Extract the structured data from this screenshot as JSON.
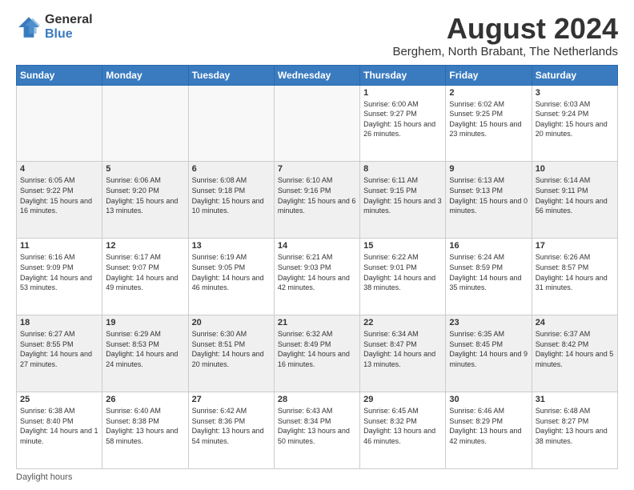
{
  "logo": {
    "general": "General",
    "blue": "Blue"
  },
  "title": "August 2024",
  "location": "Berghem, North Brabant, The Netherlands",
  "days_of_week": [
    "Sunday",
    "Monday",
    "Tuesday",
    "Wednesday",
    "Thursday",
    "Friday",
    "Saturday"
  ],
  "footer": "Daylight hours",
  "weeks": [
    {
      "shaded": false,
      "days": [
        {
          "num": "",
          "detail": ""
        },
        {
          "num": "",
          "detail": ""
        },
        {
          "num": "",
          "detail": ""
        },
        {
          "num": "",
          "detail": ""
        },
        {
          "num": "1",
          "detail": "Sunrise: 6:00 AM\nSunset: 9:27 PM\nDaylight: 15 hours\nand 26 minutes."
        },
        {
          "num": "2",
          "detail": "Sunrise: 6:02 AM\nSunset: 9:25 PM\nDaylight: 15 hours\nand 23 minutes."
        },
        {
          "num": "3",
          "detail": "Sunrise: 6:03 AM\nSunset: 9:24 PM\nDaylight: 15 hours\nand 20 minutes."
        }
      ]
    },
    {
      "shaded": true,
      "days": [
        {
          "num": "4",
          "detail": "Sunrise: 6:05 AM\nSunset: 9:22 PM\nDaylight: 15 hours\nand 16 minutes."
        },
        {
          "num": "5",
          "detail": "Sunrise: 6:06 AM\nSunset: 9:20 PM\nDaylight: 15 hours\nand 13 minutes."
        },
        {
          "num": "6",
          "detail": "Sunrise: 6:08 AM\nSunset: 9:18 PM\nDaylight: 15 hours\nand 10 minutes."
        },
        {
          "num": "7",
          "detail": "Sunrise: 6:10 AM\nSunset: 9:16 PM\nDaylight: 15 hours\nand 6 minutes."
        },
        {
          "num": "8",
          "detail": "Sunrise: 6:11 AM\nSunset: 9:15 PM\nDaylight: 15 hours\nand 3 minutes."
        },
        {
          "num": "9",
          "detail": "Sunrise: 6:13 AM\nSunset: 9:13 PM\nDaylight: 15 hours\nand 0 minutes."
        },
        {
          "num": "10",
          "detail": "Sunrise: 6:14 AM\nSunset: 9:11 PM\nDaylight: 14 hours\nand 56 minutes."
        }
      ]
    },
    {
      "shaded": false,
      "days": [
        {
          "num": "11",
          "detail": "Sunrise: 6:16 AM\nSunset: 9:09 PM\nDaylight: 14 hours\nand 53 minutes."
        },
        {
          "num": "12",
          "detail": "Sunrise: 6:17 AM\nSunset: 9:07 PM\nDaylight: 14 hours\nand 49 minutes."
        },
        {
          "num": "13",
          "detail": "Sunrise: 6:19 AM\nSunset: 9:05 PM\nDaylight: 14 hours\nand 46 minutes."
        },
        {
          "num": "14",
          "detail": "Sunrise: 6:21 AM\nSunset: 9:03 PM\nDaylight: 14 hours\nand 42 minutes."
        },
        {
          "num": "15",
          "detail": "Sunrise: 6:22 AM\nSunset: 9:01 PM\nDaylight: 14 hours\nand 38 minutes."
        },
        {
          "num": "16",
          "detail": "Sunrise: 6:24 AM\nSunset: 8:59 PM\nDaylight: 14 hours\nand 35 minutes."
        },
        {
          "num": "17",
          "detail": "Sunrise: 6:26 AM\nSunset: 8:57 PM\nDaylight: 14 hours\nand 31 minutes."
        }
      ]
    },
    {
      "shaded": true,
      "days": [
        {
          "num": "18",
          "detail": "Sunrise: 6:27 AM\nSunset: 8:55 PM\nDaylight: 14 hours\nand 27 minutes."
        },
        {
          "num": "19",
          "detail": "Sunrise: 6:29 AM\nSunset: 8:53 PM\nDaylight: 14 hours\nand 24 minutes."
        },
        {
          "num": "20",
          "detail": "Sunrise: 6:30 AM\nSunset: 8:51 PM\nDaylight: 14 hours\nand 20 minutes."
        },
        {
          "num": "21",
          "detail": "Sunrise: 6:32 AM\nSunset: 8:49 PM\nDaylight: 14 hours\nand 16 minutes."
        },
        {
          "num": "22",
          "detail": "Sunrise: 6:34 AM\nSunset: 8:47 PM\nDaylight: 14 hours\nand 13 minutes."
        },
        {
          "num": "23",
          "detail": "Sunrise: 6:35 AM\nSunset: 8:45 PM\nDaylight: 14 hours\nand 9 minutes."
        },
        {
          "num": "24",
          "detail": "Sunrise: 6:37 AM\nSunset: 8:42 PM\nDaylight: 14 hours\nand 5 minutes."
        }
      ]
    },
    {
      "shaded": false,
      "days": [
        {
          "num": "25",
          "detail": "Sunrise: 6:38 AM\nSunset: 8:40 PM\nDaylight: 14 hours\nand 1 minute."
        },
        {
          "num": "26",
          "detail": "Sunrise: 6:40 AM\nSunset: 8:38 PM\nDaylight: 13 hours\nand 58 minutes."
        },
        {
          "num": "27",
          "detail": "Sunrise: 6:42 AM\nSunset: 8:36 PM\nDaylight: 13 hours\nand 54 minutes."
        },
        {
          "num": "28",
          "detail": "Sunrise: 6:43 AM\nSunset: 8:34 PM\nDaylight: 13 hours\nand 50 minutes."
        },
        {
          "num": "29",
          "detail": "Sunrise: 6:45 AM\nSunset: 8:32 PM\nDaylight: 13 hours\nand 46 minutes."
        },
        {
          "num": "30",
          "detail": "Sunrise: 6:46 AM\nSunset: 8:29 PM\nDaylight: 13 hours\nand 42 minutes."
        },
        {
          "num": "31",
          "detail": "Sunrise: 6:48 AM\nSunset: 8:27 PM\nDaylight: 13 hours\nand 38 minutes."
        }
      ]
    }
  ]
}
